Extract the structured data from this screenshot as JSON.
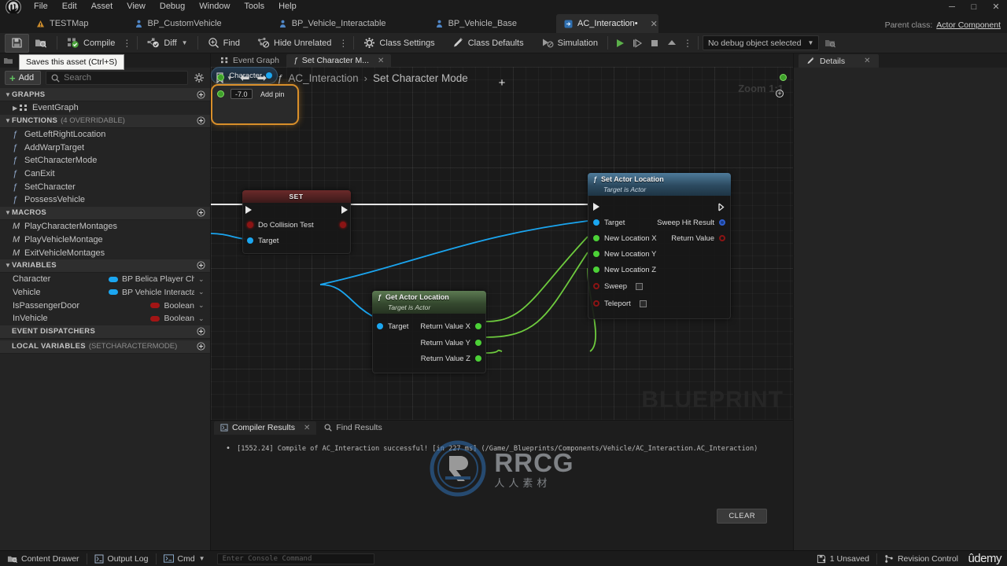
{
  "window": {
    "menu": [
      "File",
      "Edit",
      "Asset",
      "View",
      "Debug",
      "Window",
      "Tools",
      "Help"
    ],
    "controls": {
      "minimize": "─",
      "maximize": "□",
      "close": "✕"
    }
  },
  "asset_tabs": [
    {
      "label": "TESTMap",
      "icon": "level-icon",
      "active": false,
      "closable": false
    },
    {
      "label": "BP_CustomVehicle",
      "icon": "blueprint-icon",
      "active": false,
      "closable": false
    },
    {
      "label": "BP_Vehicle_Interactable",
      "icon": "blueprint-icon",
      "active": false,
      "closable": false
    },
    {
      "label": "BP_Vehicle_Base",
      "icon": "blueprint-icon",
      "active": false,
      "closable": false
    },
    {
      "label": "AC_Interaction•",
      "icon": "component-icon",
      "active": true,
      "closable": true
    }
  ],
  "parent_class": {
    "label": "Parent class:",
    "value": "Actor Component"
  },
  "toolbar": {
    "save_tooltip": "Saves this asset (Ctrl+S)",
    "save_label": "",
    "browse_label": "",
    "compile_label": "Compile",
    "diff_label": "Diff",
    "find_label": "Find",
    "hide_unrelated_label": "Hide Unrelated",
    "class_settings_label": "Class Settings",
    "class_defaults_label": "Class Defaults",
    "simulation_label": "Simulation",
    "debug_object_label": "No debug object selected"
  },
  "my_blueprint": {
    "add_label": "Add",
    "search_placeholder": "Search",
    "sections": [
      {
        "title": "GRAPHS",
        "subtitle": "",
        "items": [
          {
            "label": "EventGraph",
            "kind": "graph"
          }
        ]
      },
      {
        "title": "FUNCTIONS",
        "subtitle": "(4 OVERRIDABLE)",
        "items": [
          {
            "label": "GetLeftRightLocation",
            "kind": "function"
          },
          {
            "label": "AddWarpTarget",
            "kind": "function"
          },
          {
            "label": "SetCharacterMode",
            "kind": "function"
          },
          {
            "label": "CanExit",
            "kind": "function"
          },
          {
            "label": "SetCharacter",
            "kind": "function"
          },
          {
            "label": "PossessVehicle",
            "kind": "function"
          }
        ]
      },
      {
        "title": "MACROS",
        "subtitle": "",
        "items": [
          {
            "label": "PlayCharacterMontages",
            "kind": "macro"
          },
          {
            "label": "PlayVehicleMontage",
            "kind": "macro"
          },
          {
            "label": "ExitVehicleMontages",
            "kind": "macro"
          }
        ]
      },
      {
        "title": "VARIABLES",
        "subtitle": "",
        "items": [
          {
            "label": "Character",
            "kind": "variable",
            "type": "BP Belica Player Cha",
            "color": "#1ba6f0"
          },
          {
            "label": "Vehicle",
            "kind": "variable",
            "type": "BP Vehicle Interacta",
            "color": "#1ba6f0"
          },
          {
            "label": "IsPassengerDoor",
            "kind": "variable",
            "type": "Boolean",
            "color": "#a31515"
          },
          {
            "label": "InVehicle",
            "kind": "variable",
            "type": "Boolean",
            "color": "#a31515"
          }
        ]
      },
      {
        "title": "EVENT DISPATCHERS",
        "subtitle": "",
        "items": []
      },
      {
        "title": "LOCAL VARIABLES",
        "subtitle": "(SETCHARACTERMODE)",
        "items": []
      }
    ]
  },
  "graph": {
    "tabs": [
      {
        "label": "Event Graph",
        "active": false,
        "closable": false,
        "icon": "graph-icon"
      },
      {
        "label": "Set Character M...",
        "active": true,
        "closable": true,
        "icon": "function-icon"
      }
    ],
    "breadcrumb": {
      "root": "AC_Interaction",
      "separator": "›",
      "current": "Set Character Mode"
    },
    "zoom_label": "Zoom 1:1",
    "watermark": "BLUEPRINT",
    "nodes": [
      {
        "id": "set-node",
        "title": "SET",
        "inputs": [
          "Do Collision Test",
          "Target"
        ],
        "outputs": []
      },
      {
        "id": "character-node",
        "title": "Character"
      },
      {
        "id": "get-actor-location",
        "title": "Get Actor Location",
        "subtitle": "Target is Actor",
        "inputs": [
          "Target"
        ],
        "outputs": [
          "Return Value X",
          "Return Value Y",
          "Return Value Z"
        ]
      },
      {
        "id": "set-actor-location",
        "title": "Set Actor Location",
        "subtitle": "Target is Actor",
        "inputs": [
          "Target",
          "New Location X",
          "New Location Y",
          "New Location Z",
          "Sweep",
          "Teleport"
        ],
        "outputs": [
          "Sweep Hit Result",
          "Return Value"
        ]
      },
      {
        "id": "add-node",
        "title": "+",
        "value": "-7.0",
        "add_pin_label": "Add pin"
      }
    ]
  },
  "results": {
    "tabs": [
      {
        "label": "Compiler Results",
        "active": true,
        "closable": true,
        "icon": "compiler-icon"
      },
      {
        "label": "Find Results",
        "active": false,
        "closable": false,
        "icon": "search-icon"
      }
    ],
    "log": [
      "[1552.24] Compile of AC_Interaction successful! [in 227 ms] (/Game/_Blueprints/Components/Vehicle/AC_Interaction.AC_Interaction)"
    ],
    "clear_label": "CLEAR"
  },
  "details": {
    "tab_label": "Details"
  },
  "status_bar": {
    "content_drawer": "Content Drawer",
    "output_log": "Output Log",
    "cmd": "Cmd",
    "console_placeholder": "Enter Console Command",
    "unsaved": "1 Unsaved",
    "revision_control": "Revision Control"
  },
  "watermarks": {
    "rrcg": "RRCG",
    "rrcg_sub": "人人素材",
    "udemy": "ûdemy"
  }
}
